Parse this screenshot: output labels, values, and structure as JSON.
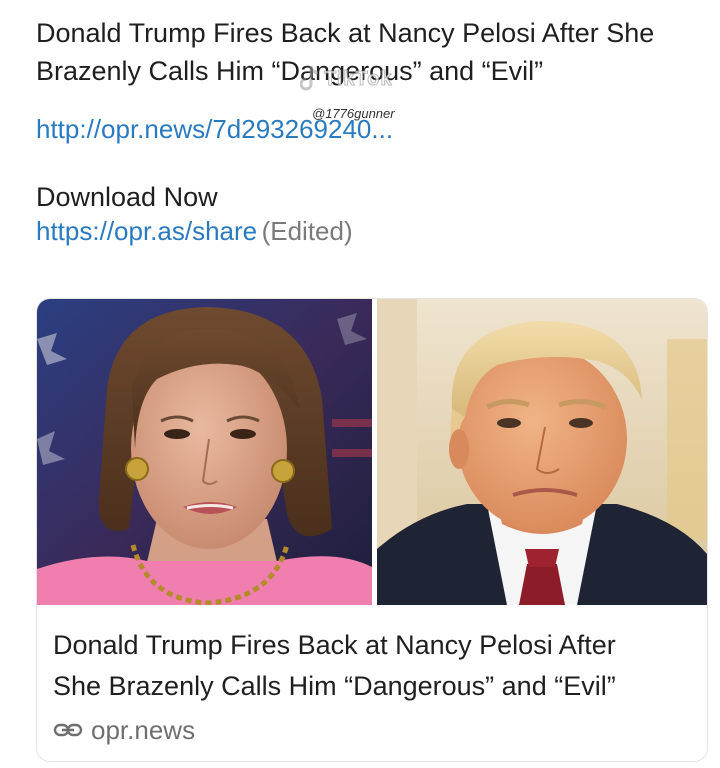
{
  "post": {
    "headline_line1": "Donald Trump Fires Back at Nancy Pelosi After She",
    "headline_line2": "Brazenly Calls Him “Dangerous” and “Evil”",
    "article_link": "http://opr.news/7d293269240...",
    "download_label": "Download Now",
    "share_link": "https://opr.as/share",
    "edited_note": "(Edited)"
  },
  "watermark": {
    "brand": "TikTok",
    "handle": "@1776gunner"
  },
  "preview_card": {
    "title_line1": "Donald Trump Fires Back at Nancy Pelosi After",
    "title_line2": "She Brazenly Calls Him “Dangerous” and “Evil”",
    "domain": "opr.news",
    "domain_icon": "link-icon",
    "left_image": "pelosi-portrait",
    "right_image": "trump-portrait"
  },
  "colors": {
    "link": "#2a7ac2",
    "text": "#1f1f1f",
    "muted": "#7a7a7a"
  }
}
